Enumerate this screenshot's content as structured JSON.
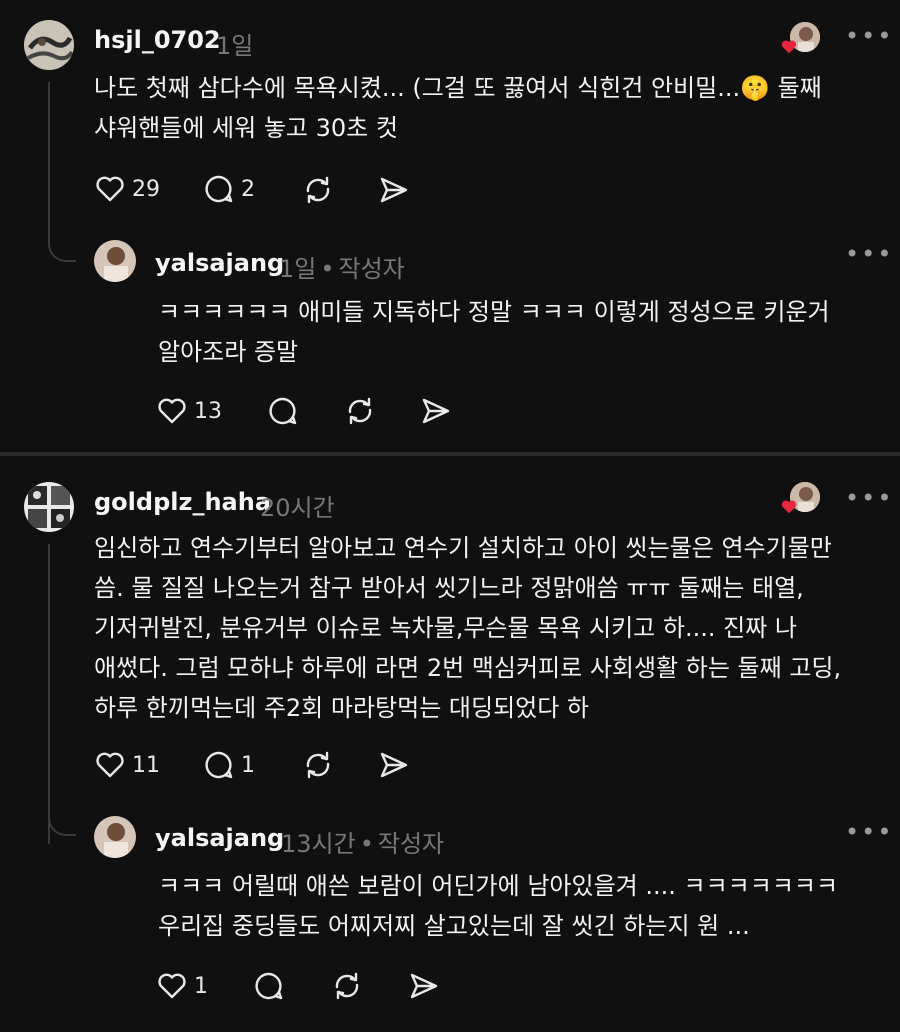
{
  "threads": [
    {
      "comment": {
        "username": "hsjl_0702",
        "time": "1일",
        "text": "나도 첫째 삼다수에 목욕시켰... (그걸 또 끓여서 식힌건 안비밀...🤫 둘째\n샤워핸들에 세워 놓고 30초 컷",
        "likes": "29",
        "replies": "2"
      },
      "reply": {
        "username": "yalsajang",
        "time": "1일",
        "author_tag": "작성자",
        "text": "ㅋㅋㅋㅋㅋㅋ 애미들 지독하다 정말 ㅋㅋㅋ 이렇게 정성으로 키운거\n알아조라 증말",
        "likes": "13"
      }
    },
    {
      "comment": {
        "username": "goldplz_haha",
        "time": "20시간",
        "text": "임신하고 연수기부터 알아보고 연수기 설치하고 아이 씻는물은 연수기물만\n씀. 물 질질 나오는거 참구 받아서 씻기느라 정맑애씀 ㅠㅠ 둘째는 태열,\n기저귀발진, 분유거부 이슈로 녹차물,무슨물 목욕 시키고 하.... 진짜 나\n애썼다. 그럼 모하냐 하루에 라면 2번 맥심커피로 사회생활  하는 둘째 고딩,\n하루 한끼먹는데 주2회 마라탕먹는 대딩되었다 하",
        "likes": "11",
        "replies": "1"
      },
      "reply": {
        "username": "yalsajang",
        "time": "13시간",
        "author_tag": "작성자",
        "text": "ㅋㅋㅋ 어릴때 애쓴 보람이 어딘가에 남아있을겨 .... ㅋㅋㅋㅋㅋㅋㅋ\n우리집 중딩들도 어찌저찌 살고있는데 잘 씻긴 하는지 원 ...",
        "likes": "1"
      }
    }
  ],
  "more_label": "•••",
  "icons": {
    "like": "heart-icon",
    "reply": "comment-bubble-icon",
    "repost": "repost-icon",
    "share": "send-icon",
    "more": "more-horizontal-icon"
  },
  "colors": {
    "background": "#101010",
    "heart_badge": "#e8263d",
    "muted": "#777777"
  }
}
